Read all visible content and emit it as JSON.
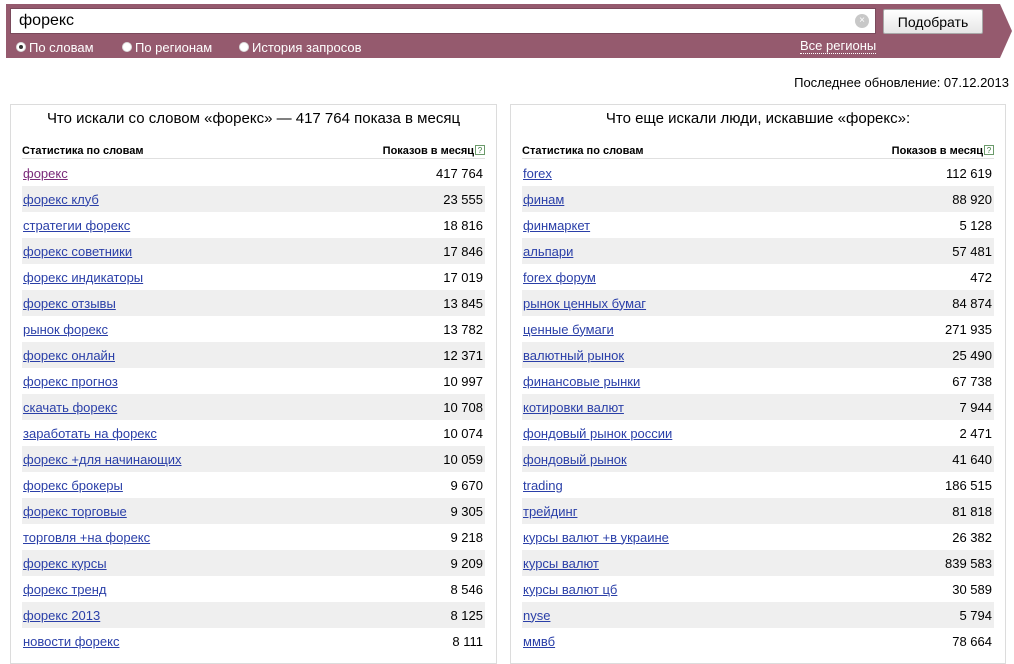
{
  "search": {
    "query": "форекс",
    "button_label": "Подобрать",
    "clear_symbol": "×"
  },
  "modes": [
    {
      "label": "По словам",
      "checked": true
    },
    {
      "label": "По регионам",
      "checked": false
    },
    {
      "label": "История запросов",
      "checked": false
    }
  ],
  "all_regions_label": "Все регионы",
  "last_update": "Последнее обновление: 07.12.2013",
  "left_panel": {
    "title": "Что искали со словом «форекс» — 417 764 показа в месяц",
    "col_term": "Статистика по словам",
    "col_count": "Показов в месяц",
    "help": "?",
    "rows": [
      {
        "term": "форекс",
        "count": "417 764"
      },
      {
        "term": "форекс клуб",
        "count": "23 555"
      },
      {
        "term": "стратегии форекс",
        "count": "18 816"
      },
      {
        "term": "форекс советники",
        "count": "17 846"
      },
      {
        "term": "форекс индикаторы",
        "count": "17 019"
      },
      {
        "term": "форекс отзывы",
        "count": "13 845"
      },
      {
        "term": "рынок форекс",
        "count": "13 782"
      },
      {
        "term": "форекс онлайн",
        "count": "12 371"
      },
      {
        "term": "форекс прогноз",
        "count": "10 997"
      },
      {
        "term": "скачать форекс",
        "count": "10 708"
      },
      {
        "term": "заработать на форекс",
        "count": "10 074"
      },
      {
        "term": "форекс +для начинающих",
        "count": "10 059"
      },
      {
        "term": "форекс брокеры",
        "count": "9 670"
      },
      {
        "term": "форекс торговые",
        "count": "9 305"
      },
      {
        "term": "торговля +на форекс",
        "count": "9 218"
      },
      {
        "term": "форекс курсы",
        "count": "9 209"
      },
      {
        "term": "форекс тренд",
        "count": "8 546"
      },
      {
        "term": "форекс 2013",
        "count": "8 125"
      },
      {
        "term": "новости форекс",
        "count": "8 111"
      }
    ]
  },
  "right_panel": {
    "title": "Что еще искали люди, искавшие «форекс»:",
    "col_term": "Статистика по словам",
    "col_count": "Показов в месяц",
    "help": "?",
    "rows": [
      {
        "term": "forex",
        "count": "112 619"
      },
      {
        "term": "финам",
        "count": "88 920"
      },
      {
        "term": "финмаркет",
        "count": "5 128"
      },
      {
        "term": "альпари",
        "count": "57 481"
      },
      {
        "term": "forex форум",
        "count": "472"
      },
      {
        "term": "рынок ценных бумаг",
        "count": "84 874"
      },
      {
        "term": "ценные бумаги",
        "count": "271 935"
      },
      {
        "term": "валютный рынок",
        "count": "25 490"
      },
      {
        "term": "финансовые рынки",
        "count": "67 738"
      },
      {
        "term": "котировки валют",
        "count": "7 944"
      },
      {
        "term": "фондовый рынок россии",
        "count": "2 471"
      },
      {
        "term": "фондовый рынок",
        "count": "41 640"
      },
      {
        "term": "trading",
        "count": "186 515"
      },
      {
        "term": "трейдинг",
        "count": "81 818"
      },
      {
        "term": "курсы валют +в украине",
        "count": "26 382"
      },
      {
        "term": "курсы валют",
        "count": "839 583"
      },
      {
        "term": "курсы валют цб",
        "count": "30 589"
      },
      {
        "term": "nyse",
        "count": "5 794"
      },
      {
        "term": "ммвб",
        "count": "78 664"
      }
    ]
  }
}
